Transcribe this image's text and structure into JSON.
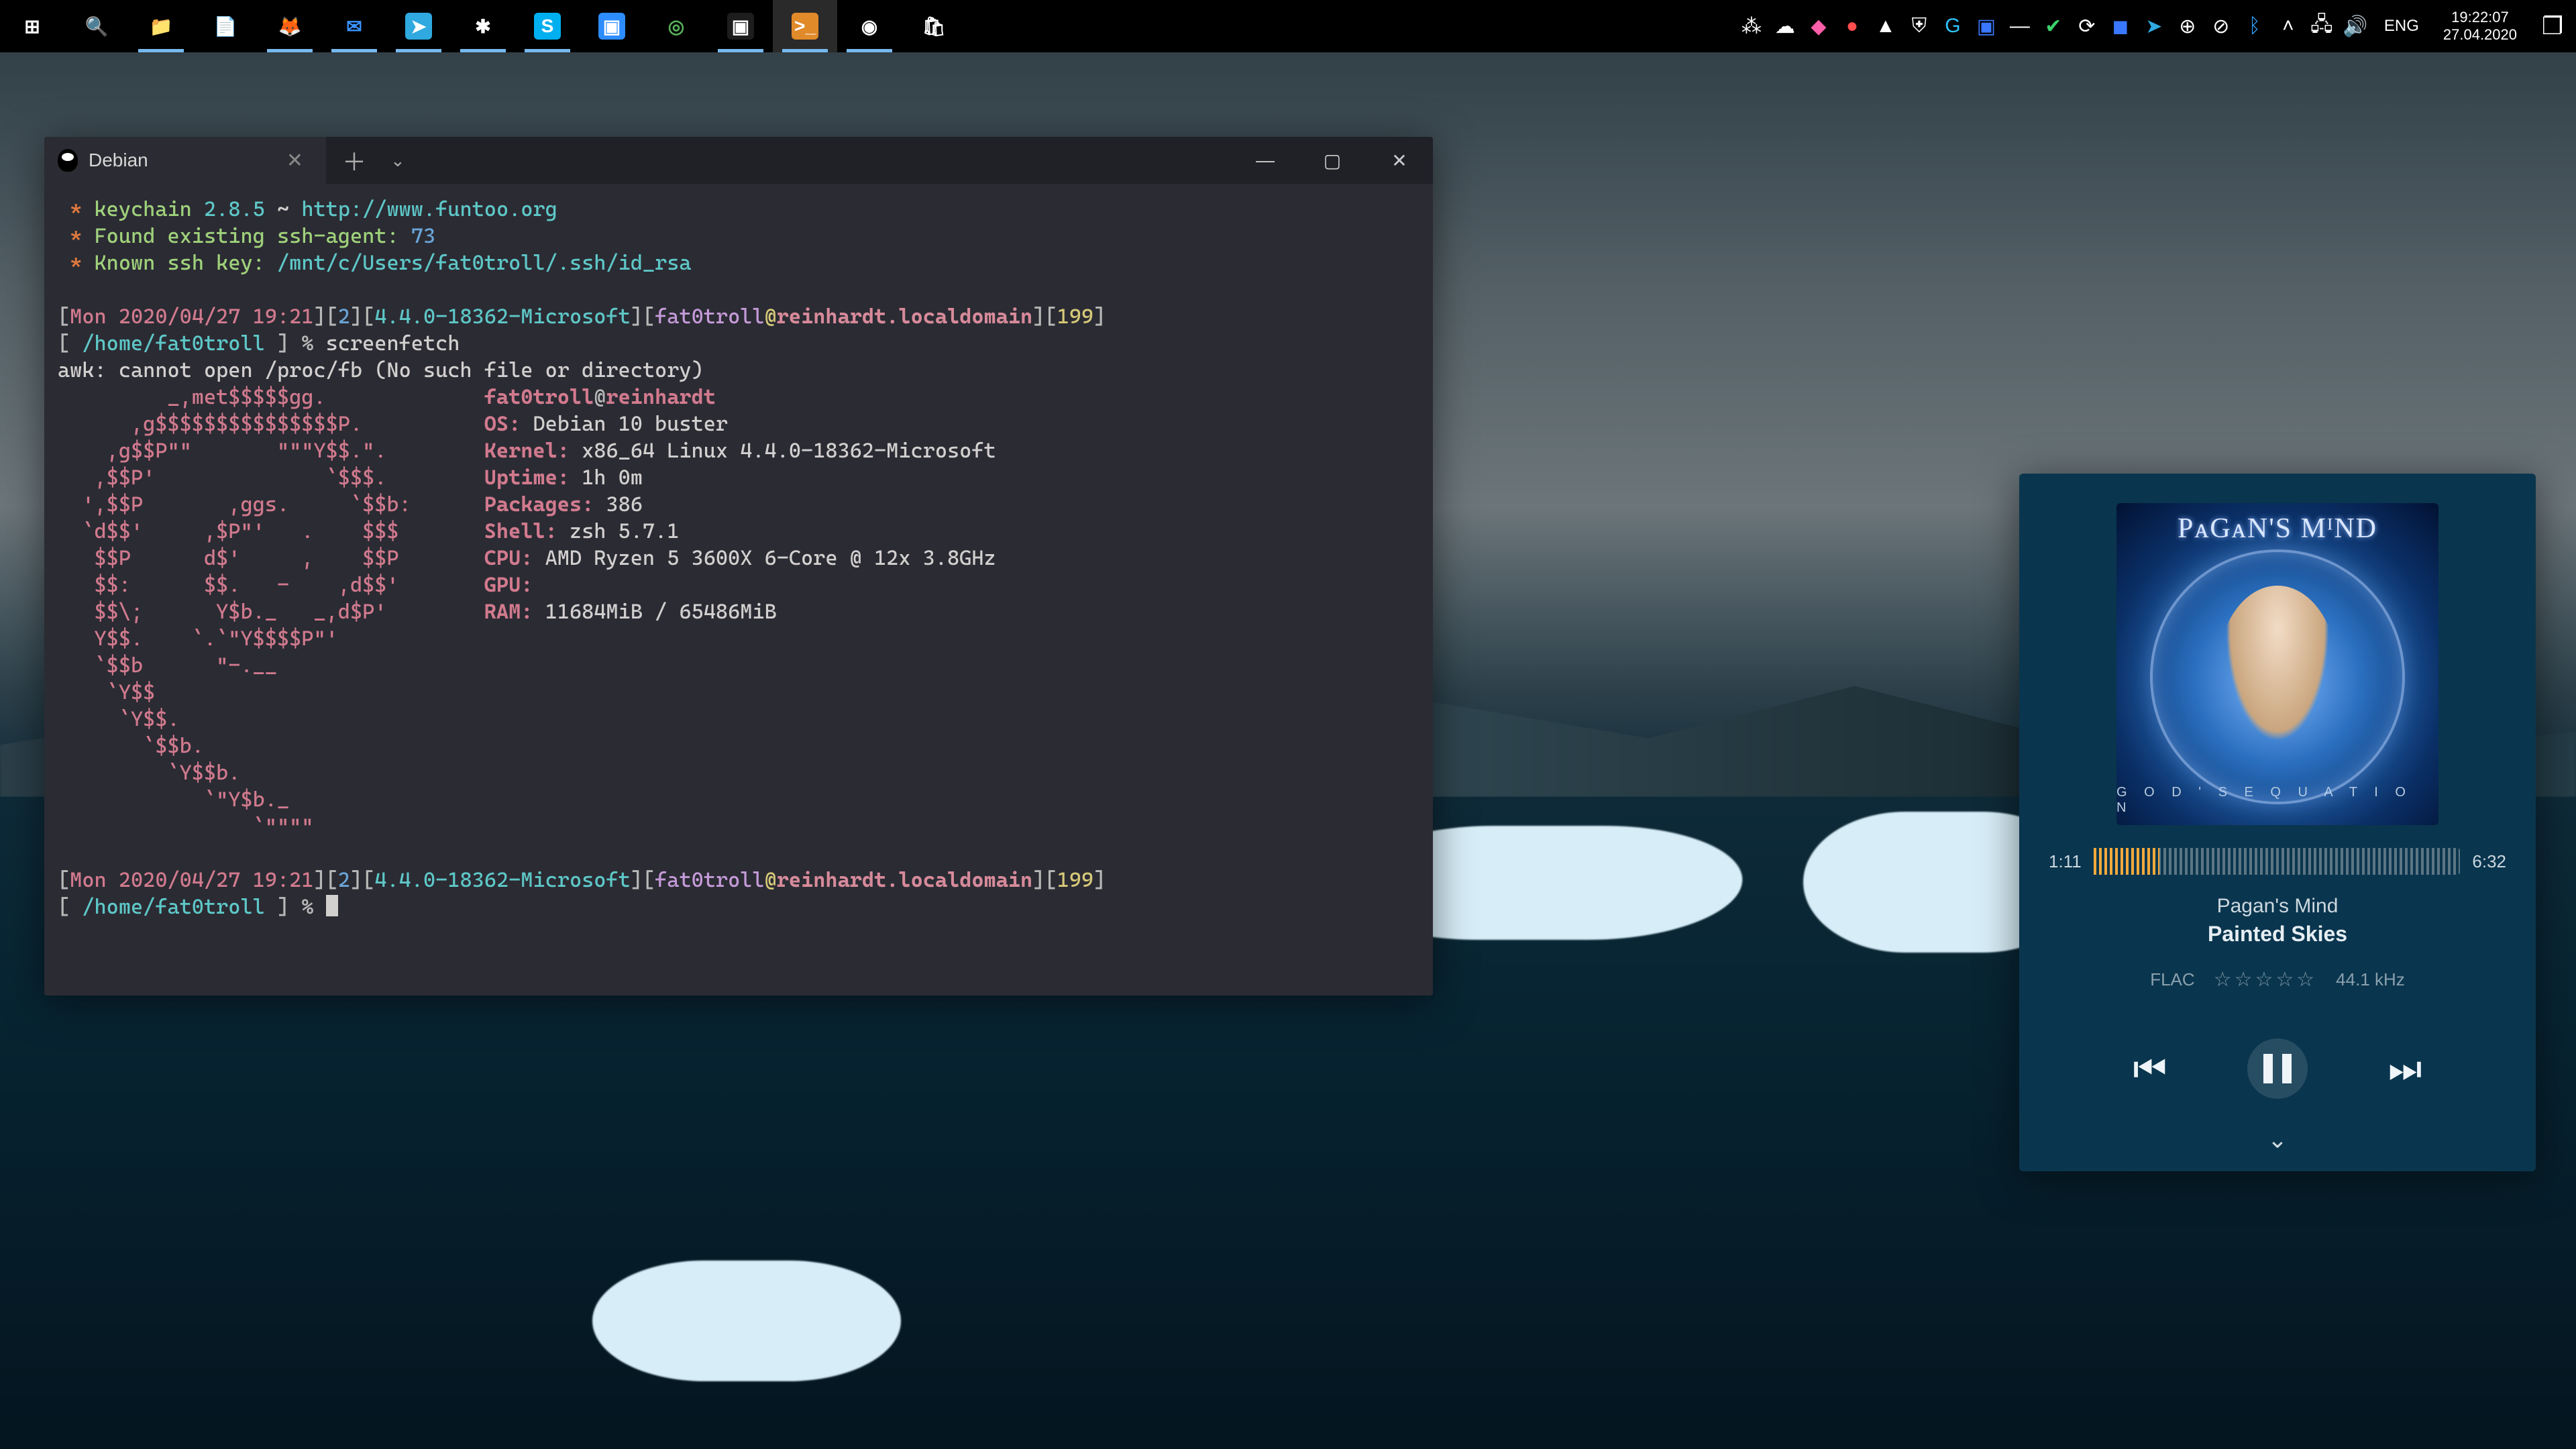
{
  "taskbar": {
    "left": [
      {
        "name": "start-button",
        "glyph": "⊞",
        "color": "#ffffff"
      },
      {
        "name": "search-icon",
        "glyph": "🔍",
        "color": "#ffffff"
      },
      {
        "name": "file-explorer-icon",
        "glyph": "📁",
        "running": true
      },
      {
        "name": "notepad-icon",
        "glyph": "📄",
        "color": "#4aa3ff"
      },
      {
        "name": "firefox-icon",
        "glyph": "🦊",
        "running": true
      },
      {
        "name": "mail-icon",
        "glyph": "✉",
        "color": "#3a93ff",
        "running": true
      },
      {
        "name": "telegram-icon",
        "glyph": "➤",
        "bg": "#2fa9e0",
        "running": true
      },
      {
        "name": "slack-icon",
        "glyph": "✱",
        "running": true
      },
      {
        "name": "skype-icon",
        "glyph": "S",
        "bg": "#00aff0",
        "running": true
      },
      {
        "name": "zoom-icon",
        "glyph": "▣",
        "bg": "#2d8cff"
      },
      {
        "name": "app-green-icon",
        "glyph": "◎",
        "color": "#59b25c"
      },
      {
        "name": "cmd-icon",
        "glyph": "▣",
        "bg": "#1d1d1d",
        "running": true,
        "active": false
      },
      {
        "name": "terminal-icon",
        "glyph": ">_",
        "bg": "#e08a2a",
        "running": true,
        "active": true
      },
      {
        "name": "pocketcasts-icon",
        "glyph": "◉",
        "color": "#ffffff",
        "running": true
      },
      {
        "name": "store-icon",
        "glyph": "🛍",
        "color": "#ffffff"
      }
    ],
    "tray": [
      {
        "name": "tray-puzzle-icon",
        "glyph": "⁂"
      },
      {
        "name": "tray-cloud-icon",
        "glyph": "☁"
      },
      {
        "name": "tray-app-pink-icon",
        "glyph": "◆",
        "color": "#ff5ea8"
      },
      {
        "name": "tray-app-red-icon",
        "glyph": "●",
        "color": "#ff4d4d"
      },
      {
        "name": "tray-onedrive-icon",
        "glyph": "▲"
      },
      {
        "name": "tray-vpn-icon",
        "glyph": "⛨"
      },
      {
        "name": "tray-logitech-icon",
        "glyph": "G",
        "color": "#2fc4ff"
      },
      {
        "name": "tray-nx-icon",
        "glyph": "▣",
        "color": "#3a78ff"
      },
      {
        "name": "tray-dash-icon",
        "glyph": "—"
      },
      {
        "name": "tray-check-icon",
        "glyph": "✔",
        "color": "#3bd46a"
      },
      {
        "name": "tray-sync-icon",
        "glyph": "⟳"
      },
      {
        "name": "tray-app-blue-icon",
        "glyph": "◼",
        "color": "#3a78ff"
      },
      {
        "name": "tray-telegram-icon",
        "glyph": "➤",
        "color": "#2fa9e0"
      },
      {
        "name": "tray-globe-icon",
        "glyph": "⊕"
      },
      {
        "name": "tray-safe-icon",
        "glyph": "⊘"
      },
      {
        "name": "tray-bluetooth-icon",
        "glyph": "ᛒ",
        "color": "#2fa3ff"
      },
      {
        "name": "tray-chevron-up-icon",
        "glyph": "˄"
      },
      {
        "name": "tray-network-icon",
        "glyph": "🖧"
      },
      {
        "name": "tray-volume-icon",
        "glyph": "🔊"
      }
    ],
    "lang": "ENG",
    "time": "19:22:07",
    "date": "27.04.2020"
  },
  "terminal": {
    "tab_title": "Debian",
    "keychain": {
      "name": "keychain",
      "version": "2.8.5",
      "sep": "~",
      "url": "http://www.funtoo.org",
      "found_line": "Found existing ssh-agent:",
      "pid": "73",
      "known_line": "Known ssh key:",
      "key_path": "/mnt/c/Users/fat0troll/.ssh/id_rsa"
    },
    "prompt": {
      "date": "Mon 2020/04/27 19:21",
      "n": "2",
      "kernel_tag": "4.4.0-18362-Microsoft",
      "user": "fat0troll",
      "host": "reinhardt.localdomain",
      "code": "199",
      "cwd": "/home/fat0troll",
      "sym": "%"
    },
    "command": "screenfetch",
    "awk_err": "awk: cannot open /proc/fb (No such file or directory)",
    "ascii": [
      "         _,met$$$$$gg.           ",
      "      ,g$$$$$$$$$$$$$$$P.        ",
      "    ,g$$P\"\"       \"\"\"Y$$.\".      ",
      "   ,$$P'              `$$$.      ",
      "  ',$$P       ,ggs.     `$$b:    ",
      "  `d$$'     ,$P\"'   .    $$$     ",
      "   $$P      d$'     ,    $$P     ",
      "   $$:      $$.   -    ,d$$'     ",
      "   $$\\;      Y$b._   _,d$P'      ",
      "   Y$$.    `.`\"Y$$$$P\"'          ",
      "   `$$b      \"-.__               ",
      "    `Y$$                         ",
      "     `Y$$.                       ",
      "       `$$b.                     ",
      "         `Y$$b.                  ",
      "            `\"Y$b._              ",
      "                `\"\"\"\"            "
    ],
    "info": {
      "userhost_user": "fat0troll",
      "userhost_host": "reinhardt",
      "OS": "Debian 10 buster",
      "Kernel": "x86_64 Linux 4.4.0-18362-Microsoft",
      "Uptime": "1h 0m",
      "Packages": "386",
      "Shell": "zsh 5.7.1",
      "CPU": "AMD Ryzen 5 3600X 6-Core @ 12x 3.8GHz",
      "GPU": "",
      "RAM": "11684MiB / 65486MiB"
    }
  },
  "music": {
    "album_band": "PᴀGᴀN'S MᴵND",
    "album_title": "G O D ' S   E Q U A T I O N",
    "elapsed": "1:11",
    "total": "6:32",
    "progress_pct": 18,
    "artist": "Pagan's Mind",
    "track": "Painted Skies",
    "format": "FLAC",
    "stars": "☆☆☆☆☆",
    "rate": "44.1 kHz"
  }
}
